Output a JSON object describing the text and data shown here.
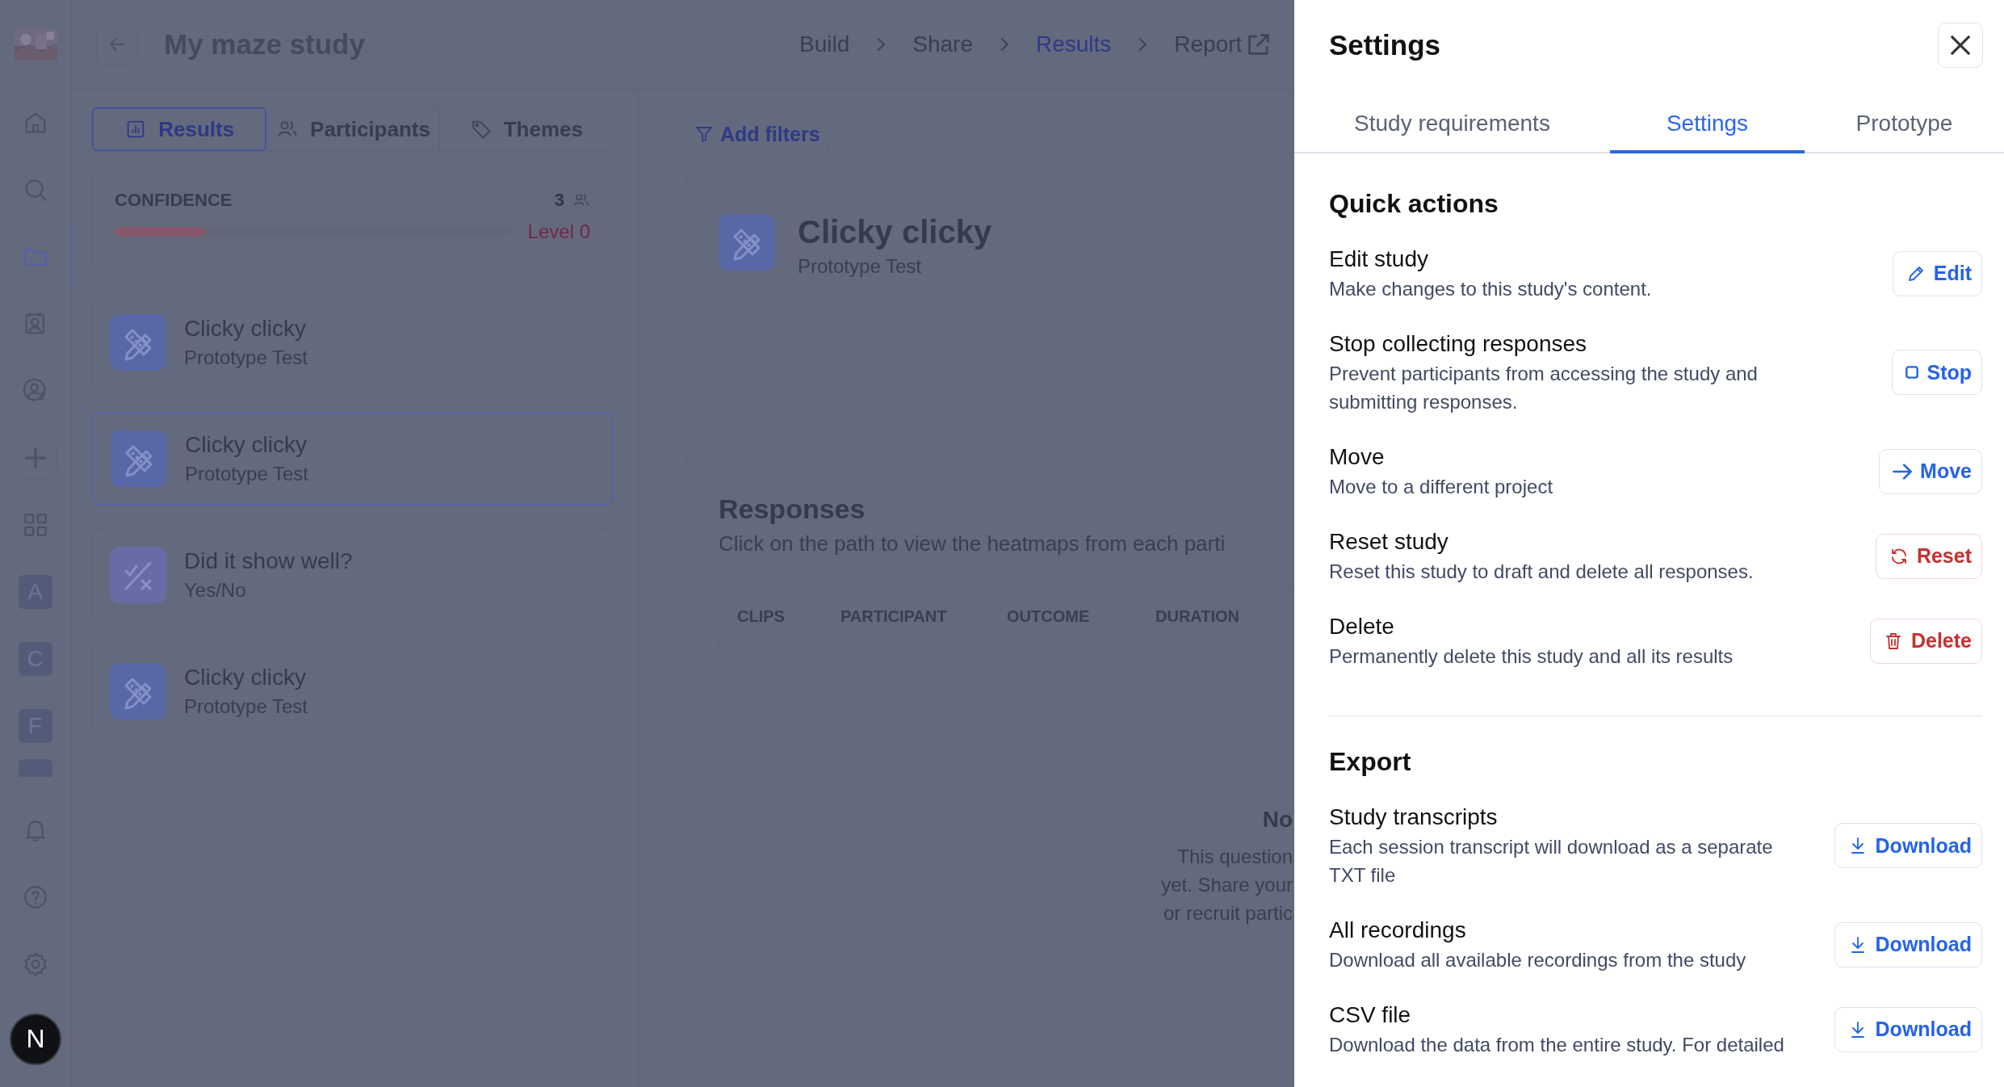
{
  "header": {
    "title": "My maze study",
    "steps": [
      {
        "label": "Build",
        "selected": false,
        "external": false
      },
      {
        "label": "Share",
        "selected": false,
        "external": false
      },
      {
        "label": "Results",
        "selected": true,
        "external": false
      },
      {
        "label": "Report",
        "selected": false,
        "external": true
      }
    ]
  },
  "rail": {
    "nav": [
      {
        "selected": false
      },
      {
        "selected": false
      },
      {
        "selected": true
      },
      {
        "selected": false
      },
      {
        "selected": false
      }
    ],
    "workspaces": [
      "A",
      "C",
      "F"
    ],
    "avatar": "N"
  },
  "view_tabs": [
    {
      "label": "Results",
      "selected": true
    },
    {
      "label": "Participants",
      "selected": false
    },
    {
      "label": "Themes",
      "selected": false
    }
  ],
  "confidence": {
    "label": "CONFIDENCE",
    "count": "3",
    "level": 0.23,
    "reading": "Level 0"
  },
  "sections": [
    {
      "title": "Clicky clicky",
      "subtitle": "Prototype Test",
      "kind": "prototype",
      "selected": false
    },
    {
      "title": "Clicky clicky",
      "subtitle": "Prototype Test",
      "kind": "prototype",
      "selected": true
    },
    {
      "title": "Did it show well?",
      "subtitle": "Yes/No",
      "kind": "yesno",
      "selected": false
    },
    {
      "title": "Clicky clicky",
      "subtitle": "Prototype Test",
      "kind": "prototype",
      "selected": false
    }
  ],
  "filters": {
    "label": "Add filters"
  },
  "detail": {
    "title": "Clicky clicky",
    "subtitle": "Prototype Test"
  },
  "responses": {
    "title": "Responses",
    "description": "Click on the path to view the heatmaps from each parti",
    "columns": [
      "CLIPS",
      "PARTICIPANT",
      "OUTCOME",
      "DURATION"
    ],
    "empty": {
      "title": "No",
      "lines": [
        "This question",
        "yet. Share your",
        "or recruit partic"
      ]
    }
  },
  "drawer": {
    "title": "Settings",
    "tabs": [
      {
        "label": "Study requirements",
        "selected": false
      },
      {
        "label": "Settings",
        "selected": true
      },
      {
        "label": "Prototype",
        "selected": false
      }
    ],
    "groups": [
      {
        "heading": "Quick actions",
        "items": [
          {
            "title": "Edit study",
            "description": "Make changes to this study's content.",
            "action": {
              "label": "Edit",
              "kind": "edit",
              "danger": false
            }
          },
          {
            "title": "Stop collecting responses",
            "description": "Prevent participants from accessing the study and submitting responses.",
            "action": {
              "label": "Stop",
              "kind": "stop",
              "danger": false
            }
          },
          {
            "title": "Move",
            "description": "Move to a different project",
            "action": {
              "label": "Move",
              "kind": "move",
              "danger": false
            }
          },
          {
            "title": "Reset study",
            "description": "Reset this study to draft and delete all responses.",
            "action": {
              "label": "Reset",
              "kind": "reset",
              "danger": true
            }
          },
          {
            "title": "Delete",
            "description": "Permanently delete this study and all its results",
            "action": {
              "label": "Delete",
              "kind": "delete",
              "danger": true
            }
          }
        ]
      },
      {
        "heading": "Export",
        "items": [
          {
            "title": "Study transcripts",
            "description": "Each session transcript will download as a separate TXT file",
            "action": {
              "label": "Download",
              "kind": "download",
              "danger": false
            }
          },
          {
            "title": "All recordings",
            "description": "Download all available recordings from the study",
            "action": {
              "label": "Download",
              "kind": "download",
              "danger": false
            }
          },
          {
            "title": "CSV file",
            "description": "Download the data from the entire study. For detailed",
            "action": {
              "label": "Download",
              "kind": "download",
              "danger": false
            }
          }
        ]
      }
    ]
  }
}
